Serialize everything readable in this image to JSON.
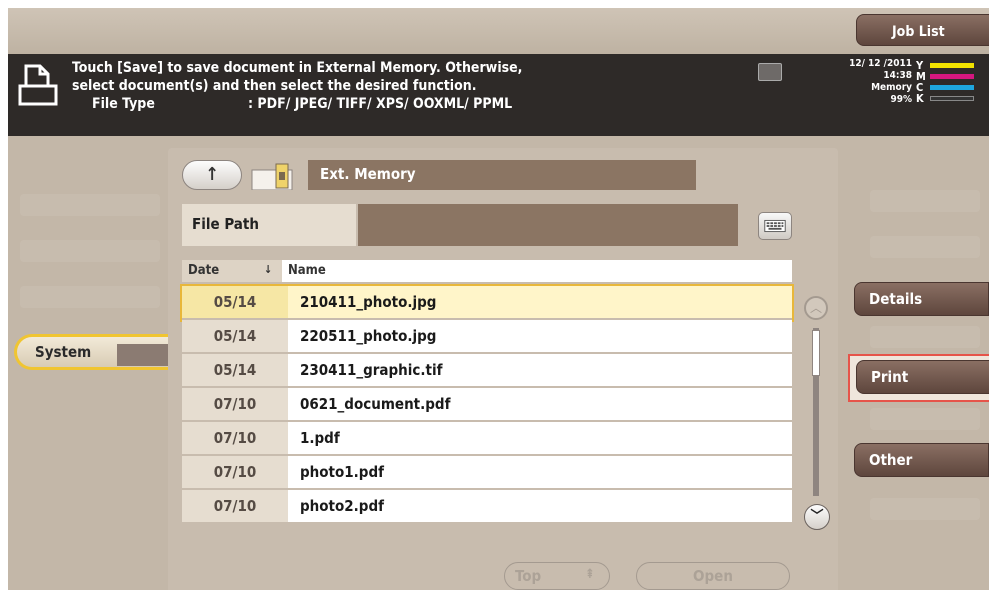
{
  "header": {
    "job_list_label": "Job List"
  },
  "message": {
    "line1": "Touch [Save] to save document in External Memory. Otherwise,",
    "line2": "select document(s) and then select the desired function.",
    "file_type_label": "File Type",
    "file_type_value": ": PDF/ JPEG/ TIFF/ XPS/ OOXML/ PPML"
  },
  "status": {
    "date": "12/ 12 /2011",
    "time": "14:38",
    "memory_label": "Memory",
    "memory_value": "99%",
    "toner": [
      {
        "letter": "Y",
        "color": "#f2e200"
      },
      {
        "letter": "M",
        "color": "#d6177f"
      },
      {
        "letter": "C",
        "color": "#1ea6de"
      },
      {
        "letter": "K",
        "color": "#333333"
      }
    ]
  },
  "left_nav": {
    "system_label": "System"
  },
  "panel": {
    "location_label": "Ext. Memory",
    "file_path_label": "File Path",
    "file_path_value": "",
    "columns": {
      "date": "Date",
      "sort_icon": "↓",
      "name": "Name"
    },
    "files": [
      {
        "date": "05/14",
        "name": "210411_photo.jpg",
        "selected": true
      },
      {
        "date": "05/14",
        "name": "220511_photo.jpg",
        "selected": false
      },
      {
        "date": "05/14",
        "name": "230411_graphic.tif",
        "selected": false
      },
      {
        "date": "07/10",
        "name": "0621_document.pdf",
        "selected": false
      },
      {
        "date": "07/10",
        "name": "1.pdf",
        "selected": false
      },
      {
        "date": "07/10",
        "name": "photo1.pdf",
        "selected": false
      },
      {
        "date": "07/10",
        "name": "photo2.pdf",
        "selected": false
      }
    ],
    "top_label": "Top",
    "open_label": "Open"
  },
  "right_nav": {
    "details_label": "Details",
    "print_label": "Print",
    "other_label": "Other"
  }
}
